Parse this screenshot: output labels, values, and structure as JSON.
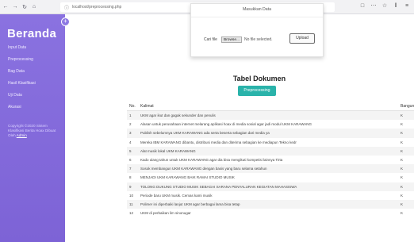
{
  "browser": {
    "url": "localhost/preprocessing.php",
    "icons": [
      "back-icon",
      "forward-icon",
      "reload-icon",
      "home-icon"
    ]
  },
  "sidebar": {
    "brand": "Beranda",
    "toggle": "+",
    "items": [
      {
        "label": "Input Data"
      },
      {
        "label": "Preprocessing"
      },
      {
        "label": "Bag Data"
      },
      {
        "label": "Hasil Klasifikasi"
      },
      {
        "label": "Uji Data"
      },
      {
        "label": "Akurasi"
      }
    ],
    "copyright_text": "Copyright ©2020 Sistem Klasifikasi Berita Hoax Dibuat Oleh",
    "copyright_link": "Admin"
  },
  "modal": {
    "title": "Masukkan Data",
    "field_label": "Cari file",
    "file_button": "Browse...",
    "file_status": "No file selected.",
    "upload_button": "Upload"
  },
  "main": {
    "title": "Tabel Dokumen",
    "button": "Preprocessing"
  },
  "table": {
    "headers": {
      "no": "No.",
      "kalimat": "Kalimat",
      "label": "Bangun"
    },
    "rows": [
      {
        "no": "1",
        "kalimat": "UKM agar ikut dan gagak sekunder dan penulis",
        "label": "K"
      },
      {
        "no": "2",
        "kalimat": "Alasan untuk perusahaan internet melarang aplikasi hoax di media sosial agar jadi modul UKM KARAWANG",
        "label": "K"
      },
      {
        "no": "3",
        "kalimat": "Publish sebelumnya UKM KARAWANG ada serta beserta sebagian dari media ya",
        "label": "K"
      },
      {
        "no": "4",
        "kalimat": "Mereka IBM KARAWANG dibantu, distribusi media dan diterima sebagian ke mediapun Tekno kedr",
        "label": "K"
      },
      {
        "no": "5",
        "kalimat": "Alat musik lokal UKM KARAWANG",
        "label": "K"
      },
      {
        "no": "6",
        "kalimat": "Kado ulang tahun untuk UKM KARAWANG agar dia bisa mengikuti kompetisi lainnya Tirta",
        "label": "K"
      },
      {
        "no": "7",
        "kalimat": "Sosok membangun UKM KARAWANG dengan basis yang baru selama setahun",
        "label": "K"
      },
      {
        "no": "8",
        "kalimat": "MENJADI UKM KARAWANG BAIK RAMAI STUDIO MUSIK",
        "label": "K"
      },
      {
        "no": "9",
        "kalimat": "TOLONG DUKUNG STUDIO MUSIK SEBAGAI SARANA PENYALURAN KEGIATAN MAHASISWA",
        "label": "K"
      },
      {
        "no": "10",
        "kalimat": "Periode baru UKM musik. Cemas kami musik",
        "label": "K"
      },
      {
        "no": "11",
        "kalimat": "Polimer ini diperbaiki lanjut UKM agar berbagai lama bisa tetap",
        "label": "K"
      },
      {
        "no": "12",
        "kalimat": "UKM di perbaikan lim sinonugar",
        "label": "K"
      }
    ]
  }
}
